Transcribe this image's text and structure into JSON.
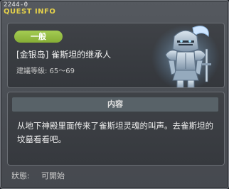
{
  "window": {
    "quest_id": "2244-0",
    "title": "QUEST INFO"
  },
  "quest": {
    "category": "一般",
    "name": "[金银岛] 雀斯坦的继承人",
    "level_requirement": "建議等級: 65～69",
    "portrait": "armored-knight-ghost"
  },
  "content": {
    "header": "内容",
    "description": "从地下神殿里面传来了雀斯坦灵魂的叫声。去雀斯坦的坟墓看看吧。"
  },
  "status": {
    "label": "狀態:",
    "value": "可開始"
  },
  "colors": {
    "title": "#e6d24a",
    "badge": "#96bc44"
  }
}
